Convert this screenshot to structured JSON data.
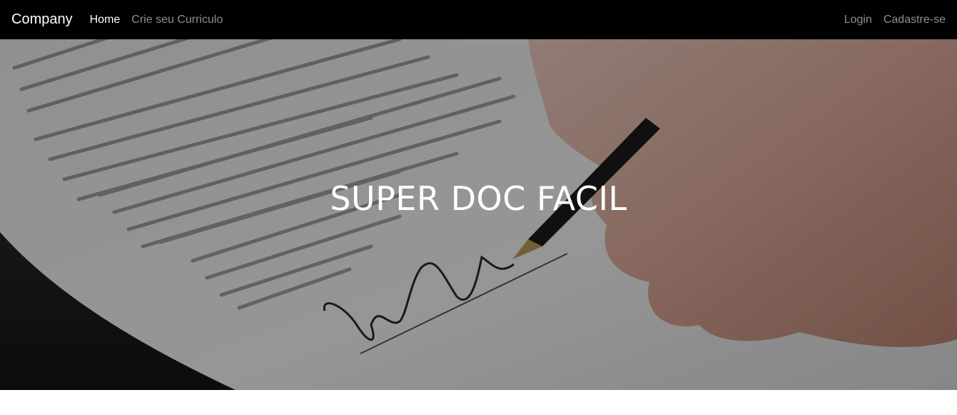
{
  "navbar": {
    "brand": "Company",
    "left_links": [
      {
        "label": "Home",
        "active": true
      },
      {
        "label": "Crie seu Curriculo",
        "active": false
      }
    ],
    "right_links": [
      {
        "label": "Login"
      },
      {
        "label": "Cadastre-se"
      }
    ]
  },
  "hero": {
    "title": "SUPER DOC FACIL",
    "image": "document-signing-photo",
    "overlay_color": "#000000"
  },
  "colors": {
    "navbar_bg": "#000000",
    "link_active": "#ffffff",
    "link_muted": "#8c8c8c"
  }
}
